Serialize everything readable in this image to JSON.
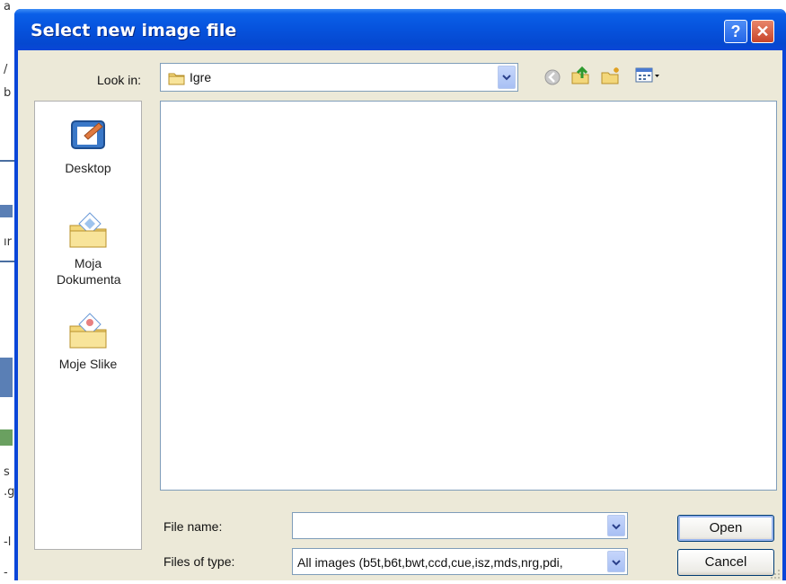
{
  "dialog": {
    "title": "Select new image file"
  },
  "look_in": {
    "label": "Look in:",
    "value": "Igre"
  },
  "toolbar_icons": [
    "back-icon",
    "up-folder-icon",
    "new-folder-icon",
    "view-menu-icon"
  ],
  "places": [
    {
      "label": "Desktop",
      "icon": "desktop-icon"
    },
    {
      "label": "Moja Dokumenta",
      "icon": "my-documents-icon"
    },
    {
      "label": "Moje Slike",
      "icon": "my-pictures-icon"
    }
  ],
  "file_name": {
    "label": "File name:",
    "value": ""
  },
  "file_type": {
    "label": "Files of type:",
    "value": "All images (b5t,b6t,bwt,ccd,cue,isz,mds,nrg,pdi,"
  },
  "buttons": {
    "open": "Open",
    "cancel": "Cancel"
  },
  "colors": {
    "titlebar": "#0a46d8",
    "client": "#ece9d8",
    "close": "#c8452a"
  }
}
